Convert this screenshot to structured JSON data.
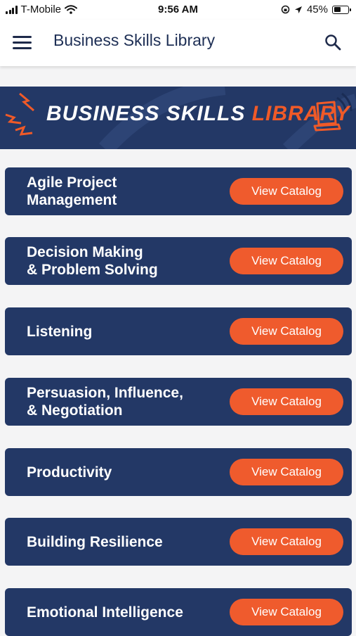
{
  "status_bar": {
    "carrier": "T-Mobile",
    "time": "9:56 AM",
    "battery": "45%",
    "battery_level": 0.45
  },
  "header": {
    "title": "Business Skills Library",
    "menu_icon": "hamburger-menu-icon",
    "search_icon": "search-icon"
  },
  "banner": {
    "text_part1": "BUSINESS SKILLS",
    "text_part2": "LIBRARY",
    "accent_color": "#f05a28",
    "background_color": "#233866"
  },
  "catalog": {
    "button_label": "View Catalog",
    "items": [
      {
        "title": "Agile Project\nManagement"
      },
      {
        "title": "Decision Making\n& Problem Solving"
      },
      {
        "title": "Listening"
      },
      {
        "title": "Persuasion, Influence,\n& Negotiation"
      },
      {
        "title": "Productivity"
      },
      {
        "title": "Building Resilience"
      },
      {
        "title": "Emotional Intelligence"
      }
    ]
  },
  "colors": {
    "card_background": "#233866",
    "button_background": "#ef5b2d",
    "page_background": "#f4f4f5"
  }
}
